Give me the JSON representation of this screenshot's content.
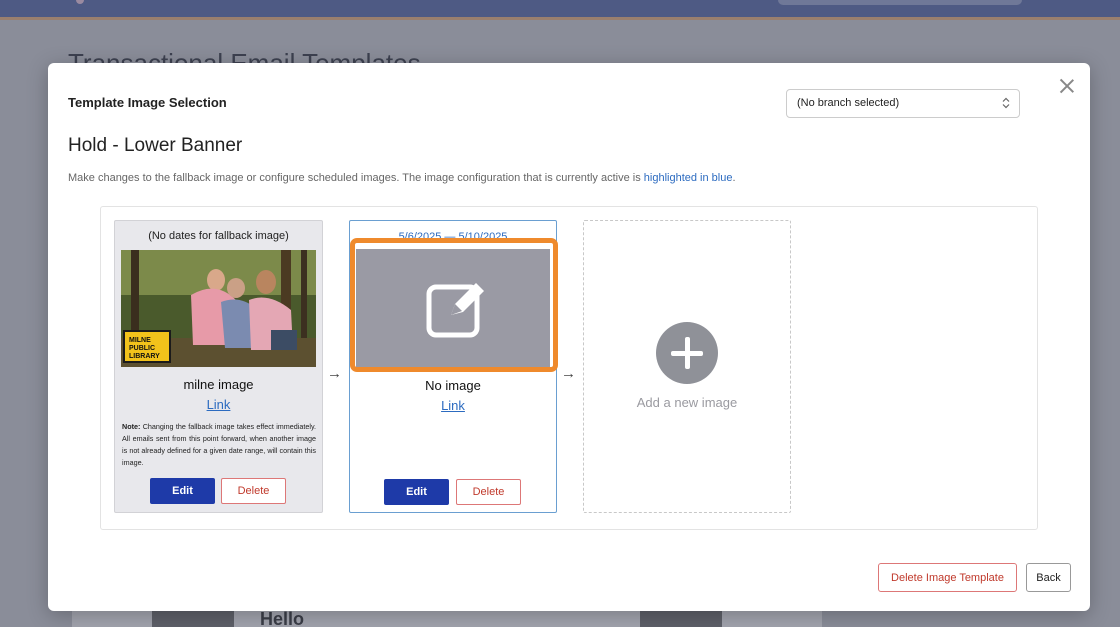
{
  "background": {
    "page_title": "Transactional Email Templates",
    "greeting": "Hello"
  },
  "modal": {
    "title": "Template Image Selection",
    "branch_select": {
      "value": "(No branch selected)"
    },
    "template_name": "Hold - Lower Banner",
    "description_prefix": "Make changes to the fallback image or configure scheduled images. The image configuration that is currently active is ",
    "description_highlight": "highlighted in blue",
    "description_suffix": ".",
    "fallback_card": {
      "dates": "(No dates for fallback image)",
      "logo_text": "MILNE PUBLIC LIBRARY",
      "image_name": "milne image",
      "link": "Link",
      "note_label": "Note:",
      "note_text": " Changing the fallback image takes effect immediately. All emails sent from this point forward, when another image is not already defined for a given date range, will contain this image.",
      "edit_label": "Edit",
      "delete_label": "Delete"
    },
    "scheduled_card": {
      "dates": "5/6/2025 — 5/10/2025",
      "image_name": "No image",
      "link": "Link",
      "edit_label": "Edit",
      "delete_label": "Delete",
      "active": true
    },
    "arrow_glyph": "→",
    "add_card": {
      "label": "Add a new image"
    },
    "footer": {
      "delete_template_label": "Delete Image Template",
      "back_label": "Back"
    }
  },
  "colors": {
    "primary_button": "#1e3aa8",
    "danger": "#c0392b",
    "active_border": "#6a9fd1",
    "link": "#2c6bc0",
    "focus_highlight": "#ef8a2c"
  },
  "icons": {
    "close": "close-icon",
    "select_caret": "chevron-updown-icon",
    "edit": "edit-square-icon",
    "add": "plus-circle-icon"
  }
}
